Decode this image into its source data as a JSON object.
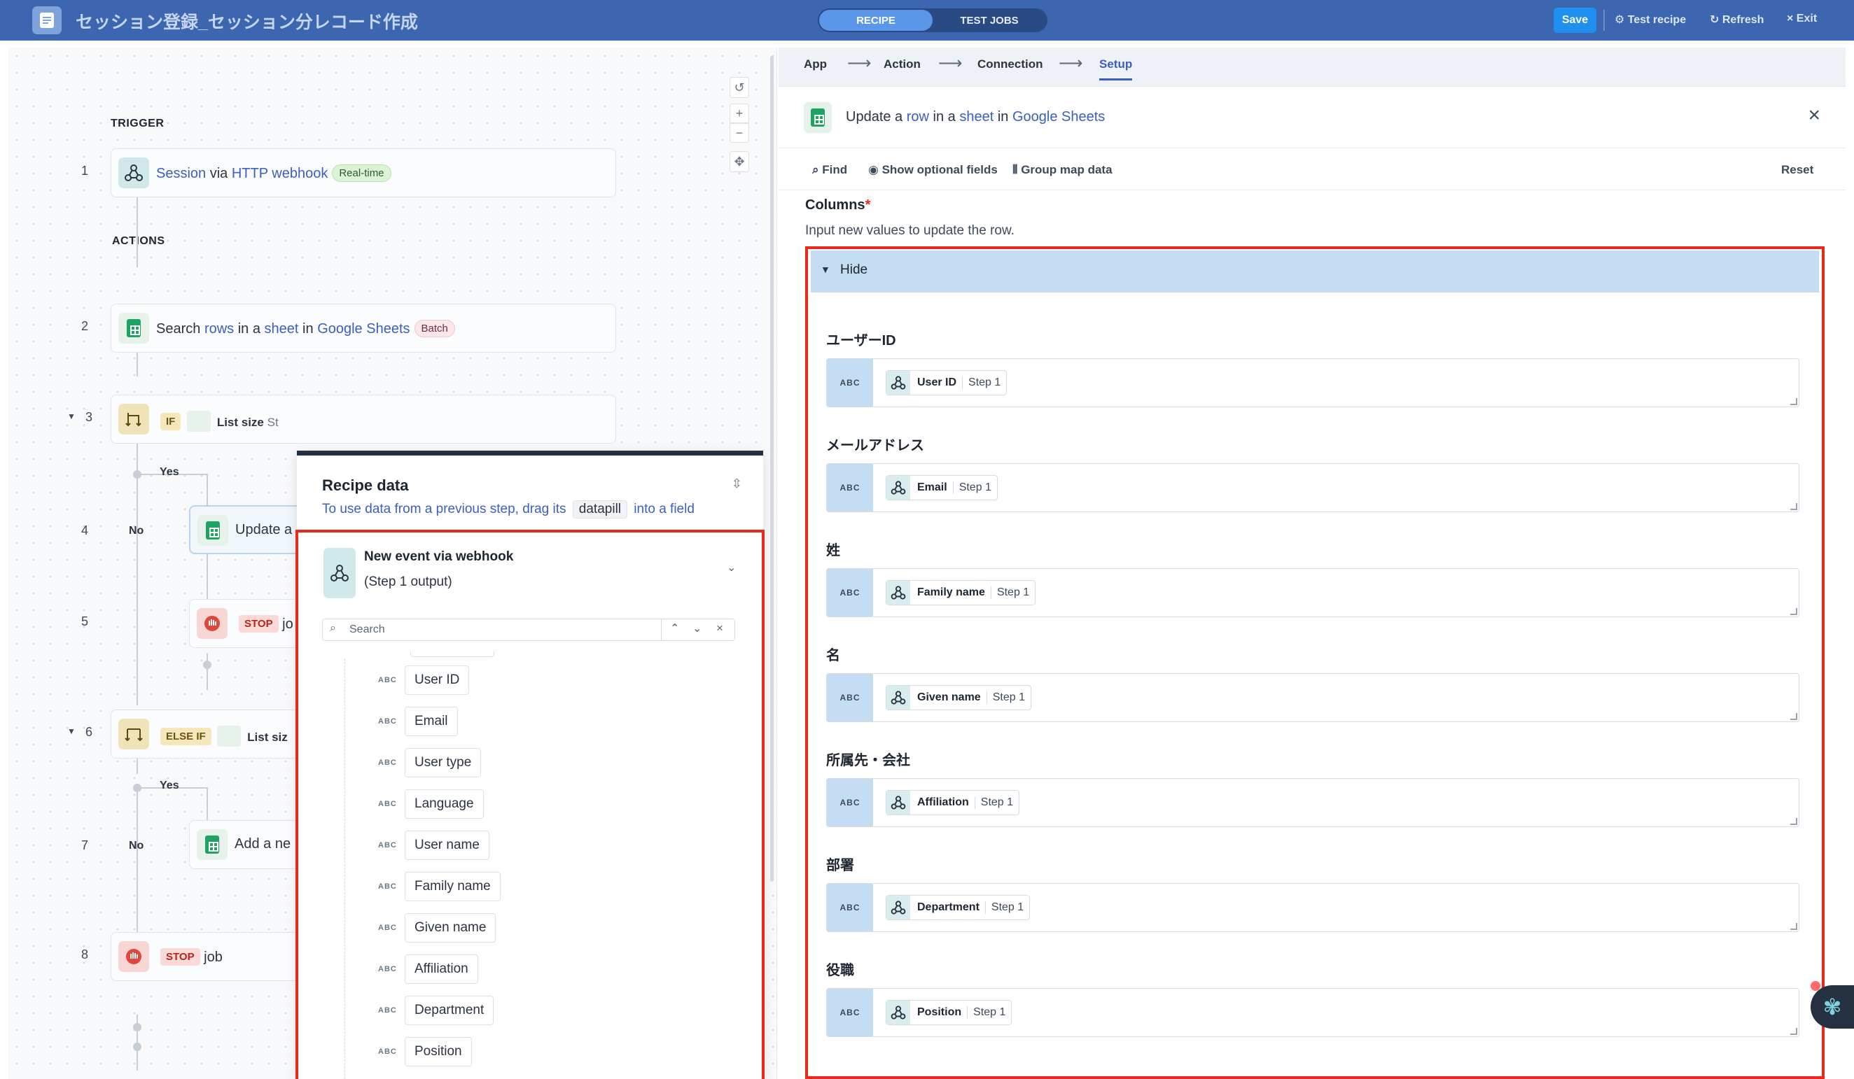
{
  "header": {
    "title": "セッション登録_セッション分レコード作成",
    "tabs": [
      "RECIPE",
      "TEST JOBS"
    ],
    "save": "Save",
    "test_recipe": "Test recipe",
    "refresh": "Refresh",
    "exit": "Exit"
  },
  "canvas": {
    "trigger_label": "TRIGGER",
    "actions_label": "ACTIONS",
    "step_numbers": [
      "1",
      "2",
      "3",
      "4",
      "5",
      "6",
      "7",
      "8"
    ],
    "step1": {
      "a": "Session",
      "b": "via",
      "c": "HTTP webhook",
      "tag": "Real-time"
    },
    "step2": {
      "a": "Search",
      "b": "rows",
      "c": "in a",
      "d": "sheet",
      "e": "in",
      "f": "Google Sheets",
      "tag": "Batch"
    },
    "step3": {
      "kw": "IF",
      "text": "List size",
      "tail": "St"
    },
    "step4": {
      "text": "Update a"
    },
    "step5": {
      "kw": "STOP",
      "tail": "jo"
    },
    "step6": {
      "kw": "ELSE IF",
      "text": "List siz"
    },
    "step7": {
      "text": "Add a ne"
    },
    "step8": {
      "kw": "STOP",
      "text": "job"
    },
    "yes": "Yes",
    "no": "No"
  },
  "recipe_data": {
    "title": "Recipe data",
    "sub_a": "To use data from a previous step, drag its",
    "chip": "datapill",
    "sub_b": "into a field",
    "source_title": "New event via webhook",
    "source_sub": "(Step 1 output)",
    "search_placeholder": "Search",
    "type": "ABC",
    "fields": [
      "User ID",
      "Email",
      "User type",
      "Language",
      "User name",
      "Family name",
      "Given name",
      "Affiliation",
      "Department",
      "Position"
    ]
  },
  "setup": {
    "crumbs": [
      "App",
      "Action",
      "Connection",
      "Setup"
    ],
    "action": {
      "a": "Update a",
      "b": "row",
      "c": "in a",
      "d": "sheet",
      "e": "in",
      "f": "Google Sheets"
    },
    "tools": {
      "find": "Find",
      "optional": "Show optional fields",
      "group": "Group map data",
      "reset": "Reset"
    },
    "columns_label": "Columns",
    "required_mark": "*",
    "columns_hint": "Input new values to update the row.",
    "hide": "Hide",
    "type": "ABC",
    "step_label": "Step 1",
    "fields": [
      {
        "label": "ユーザーID",
        "pill": "User ID"
      },
      {
        "label": "メールアドレス",
        "pill": "Email"
      },
      {
        "label": "姓",
        "pill": "Family name"
      },
      {
        "label": "名",
        "pill": "Given name"
      },
      {
        "label": "所属先・会社",
        "pill": "Affiliation"
      },
      {
        "label": "部署",
        "pill": "Department"
      },
      {
        "label": "役職",
        "pill": "Position"
      }
    ]
  },
  "colors": {
    "topbar": "#3c66b0",
    "accent": "#3b5fc0",
    "highlight": "#e8291c",
    "sheets_green": "#1ea362"
  }
}
